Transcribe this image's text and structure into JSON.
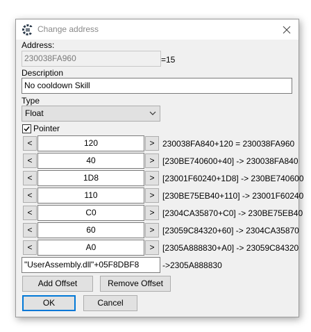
{
  "window": {
    "title": "Change address"
  },
  "address": {
    "label": "Address:",
    "value": "230038FA960",
    "size_suffix": "=15"
  },
  "description": {
    "label": "Description",
    "value": "No cooldown Skill"
  },
  "type": {
    "label": "Type",
    "selected": "Float"
  },
  "pointer": {
    "label": "Pointer",
    "checked": true
  },
  "offsets": [
    {
      "value": "120",
      "info": "230038FA840+120 = 230038FA960"
    },
    {
      "value": "40",
      "info": "[230BE740600+40] -> 230038FA840"
    },
    {
      "value": "1D8",
      "info": "[23001F60240+1D8] -> 230BE740600"
    },
    {
      "value": "110",
      "info": "[230BE75EB40+110] -> 23001F60240"
    },
    {
      "value": "C0",
      "info": "[2304CA35870+C0] -> 230BE75EB40"
    },
    {
      "value": "60",
      "info": "[23059C84320+60] -> 2304CA35870"
    },
    {
      "value": "A0",
      "info": "[2305A888830+A0] -> 23059C84320"
    }
  ],
  "base": {
    "value": "\"UserAssembly.dll\"+05F8DBF8",
    "result": "->2305A888830"
  },
  "buttons": {
    "add_offset": "Add Offset",
    "remove_offset": "Remove Offset",
    "ok": "OK",
    "cancel": "Cancel",
    "decrement": "<",
    "increment": ">"
  }
}
